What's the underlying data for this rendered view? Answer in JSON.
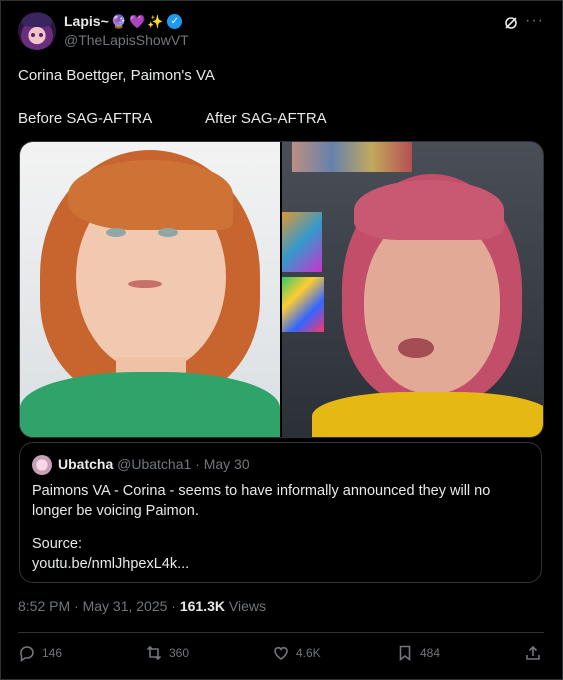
{
  "author": {
    "display_name": "Lapis~",
    "emojis": [
      "🔮",
      "💜",
      "✨"
    ],
    "handle": "@TheLapisShowVT"
  },
  "tweet": {
    "text": "Corina Boettger, Paimon's VA",
    "label_before": "Before SAG-AFTRA",
    "label_after": "After SAG-AFTRA"
  },
  "quoted": {
    "name": "Ubatcha",
    "handle_date": "@Ubatcha1 · May 30",
    "text": "Paimons VA - Corina - seems to have informally announced they will no longer be voicing Paimon.",
    "source_label": "Source:",
    "source_link": "youtu.be/nmlJhpexL4k..."
  },
  "meta": {
    "time_date": "8:52 PM · May 31, 2025 · ",
    "views_count": "161.3K",
    "views_label": " Views"
  },
  "actions": {
    "replies": "146",
    "reposts": "360",
    "likes": "4.6K",
    "bookmarks": "484"
  },
  "colors": {
    "background": "#000000",
    "text": "#e7e9ea",
    "muted": "#71767b",
    "border": "#2f3336",
    "verified": "#1d9bf0"
  }
}
